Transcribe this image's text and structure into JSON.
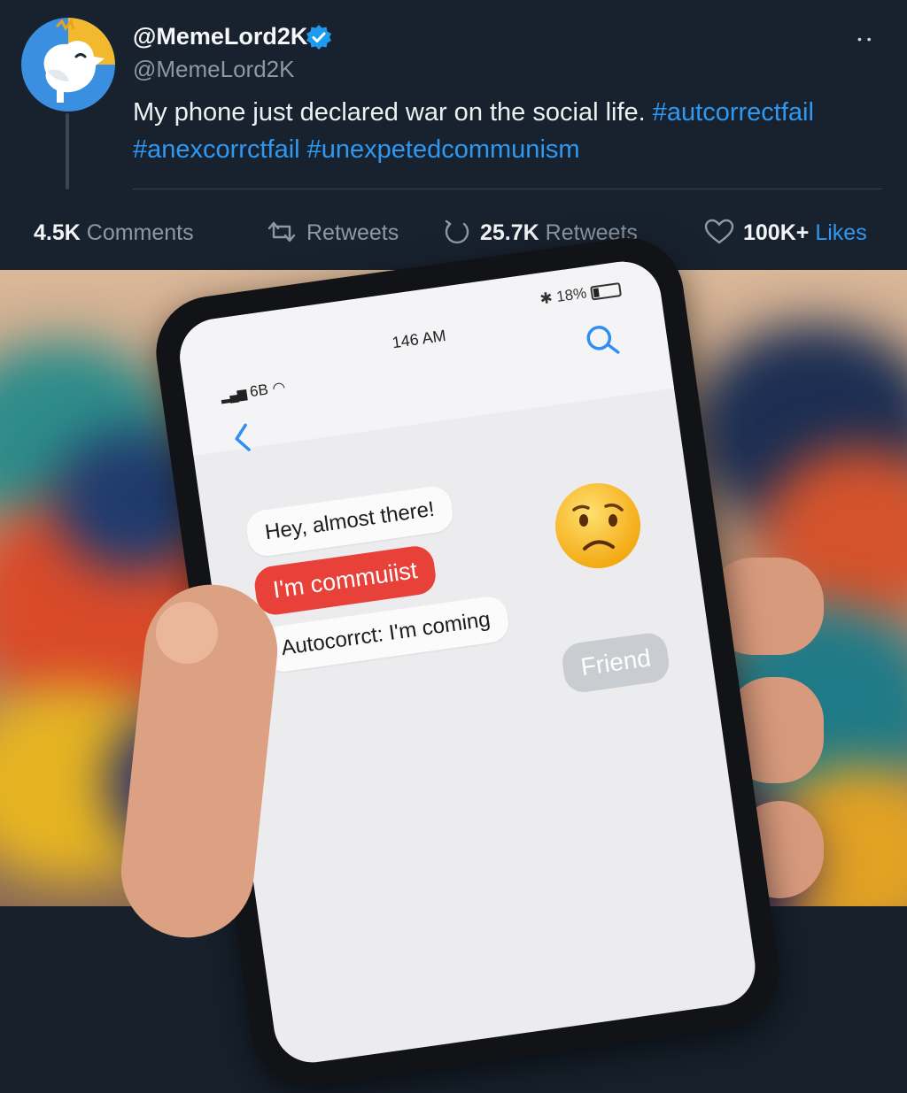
{
  "tweet": {
    "display_name": "@MemeLord2K",
    "handle": "@MemeLord2K",
    "text": "My phone just declared war on the social life.",
    "hashtags": [
      "#autcorrectfail",
      "#anexcorrctfail",
      "#unexpetedcommunism"
    ]
  },
  "stats": {
    "comments_count": "4.5K",
    "comments_label": "Comments",
    "retweets_label": "Retweets",
    "retweets2_count": "25.7K",
    "retweets2_label": "Retweets",
    "likes_count": "100K+",
    "likes_label": "Likes"
  },
  "phone": {
    "carrier": "6B",
    "time": "146 AM",
    "battery": "18%",
    "messages": [
      {
        "text": "Hey, almost there!"
      },
      {
        "text": "I'm commuiist"
      },
      {
        "text": "Autocorrct: I'm coming"
      },
      {
        "text": "Friend"
      }
    ]
  },
  "icons": {
    "verified": "verified-badge-icon",
    "comment": "comment-icon",
    "retweet": "retweet-icon",
    "like": "heart-icon",
    "back": "chevron-left-icon",
    "search": "search-icon",
    "emoji": "worried-face-emoji"
  },
  "colors": {
    "background": "#18222f",
    "accent": "#2f98f0",
    "red_bubble": "#e8413a"
  }
}
